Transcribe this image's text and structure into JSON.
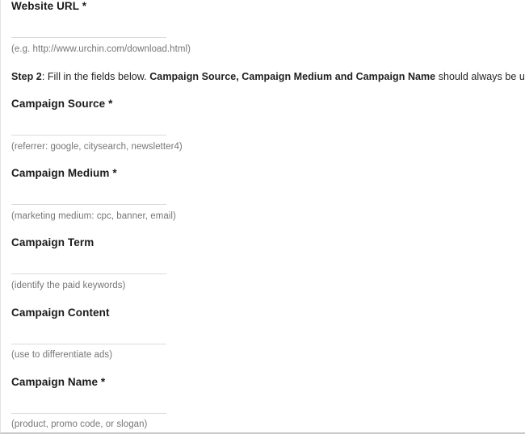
{
  "form": {
    "fields": [
      {
        "label": "Website URL *",
        "hint": "(e.g. http://www.urchin.com/download.html)",
        "value": "",
        "placeholder": "",
        "required": true
      },
      {
        "label": "Campaign Source *",
        "hint": "(referrer: google, citysearch, newsletter4)",
        "value": "",
        "placeholder": "",
        "required": true
      },
      {
        "label": "Campaign Medium *",
        "hint": "(marketing medium: cpc, banner, email)",
        "value": "",
        "placeholder": "",
        "required": true
      },
      {
        "label": "Campaign Term",
        "hint": "(identify the paid keywords)",
        "value": "",
        "placeholder": "",
        "required": false
      },
      {
        "label": "Campaign Content",
        "hint": "(use to differentiate ads)",
        "value": "",
        "placeholder": "",
        "required": false
      },
      {
        "label": "Campaign Name *",
        "hint": "(product, promo code, or slogan)",
        "value": "",
        "placeholder": "",
        "required": true
      }
    ],
    "step_note": {
      "step_prefix": "Step 2",
      "text_1": ": Fill in the fields below. ",
      "emphasis": "Campaign Source, Campaign Medium and Campaign Name",
      "text_2": " should always be used."
    }
  },
  "colors": {
    "text": "#1a1a1a",
    "hint": "#767676",
    "underline": "#dcdcdc",
    "page_border": "#e3e3e3",
    "bottom_border": "#c9c9c9",
    "background": "#ffffff"
  }
}
